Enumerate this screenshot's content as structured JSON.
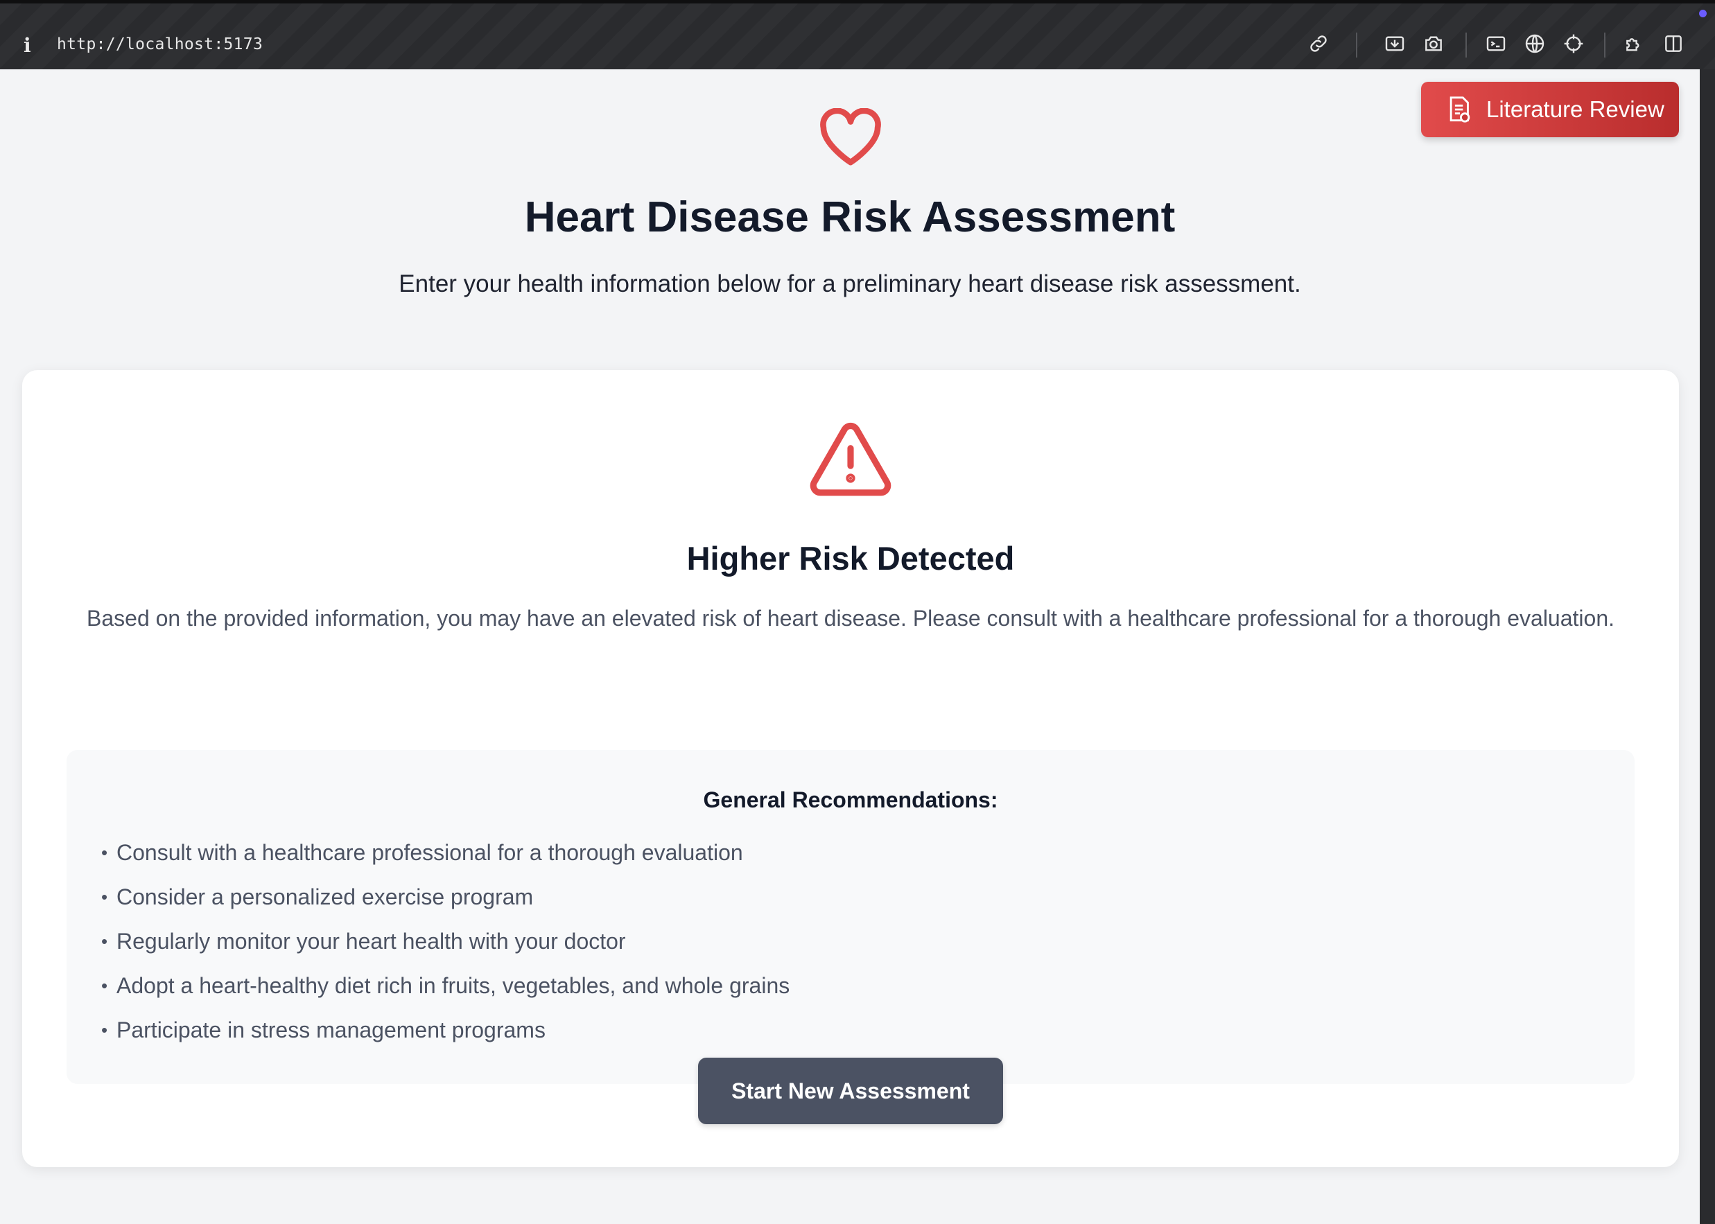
{
  "browser": {
    "url": "http://localhost:5173",
    "icons": [
      "link-icon",
      "screen-capture-icon",
      "camera-icon",
      "terminal-icon",
      "globe-icon",
      "crosshair-icon",
      "puzzle-icon",
      "split-view-icon"
    ]
  },
  "header": {
    "literature_button": "Literature Review",
    "title": "Heart Disease Risk Assessment",
    "subtitle": "Enter your health information below for a preliminary heart disease risk assessment."
  },
  "result": {
    "title": "Higher Risk Detected",
    "description": "Based on the provided information, you may have an elevated risk of heart disease. Please consult with a healthcare professional for a thorough evaluation.",
    "recommendations_title": "General Recommendations:",
    "recommendations": [
      "Consult with a healthcare professional for a thorough evaluation",
      "Consider a personalized exercise program",
      "Regularly monitor your heart health with your doctor",
      "Adopt a heart-healthy diet rich in fruits, vegetables, and whole grains",
      "Participate in stress management programs"
    ],
    "new_assessment_button": "Start New Assessment"
  },
  "colors": {
    "accent_red": "#e14b4b",
    "title_text": "#131a2a",
    "button_gray": "#4b5263"
  }
}
